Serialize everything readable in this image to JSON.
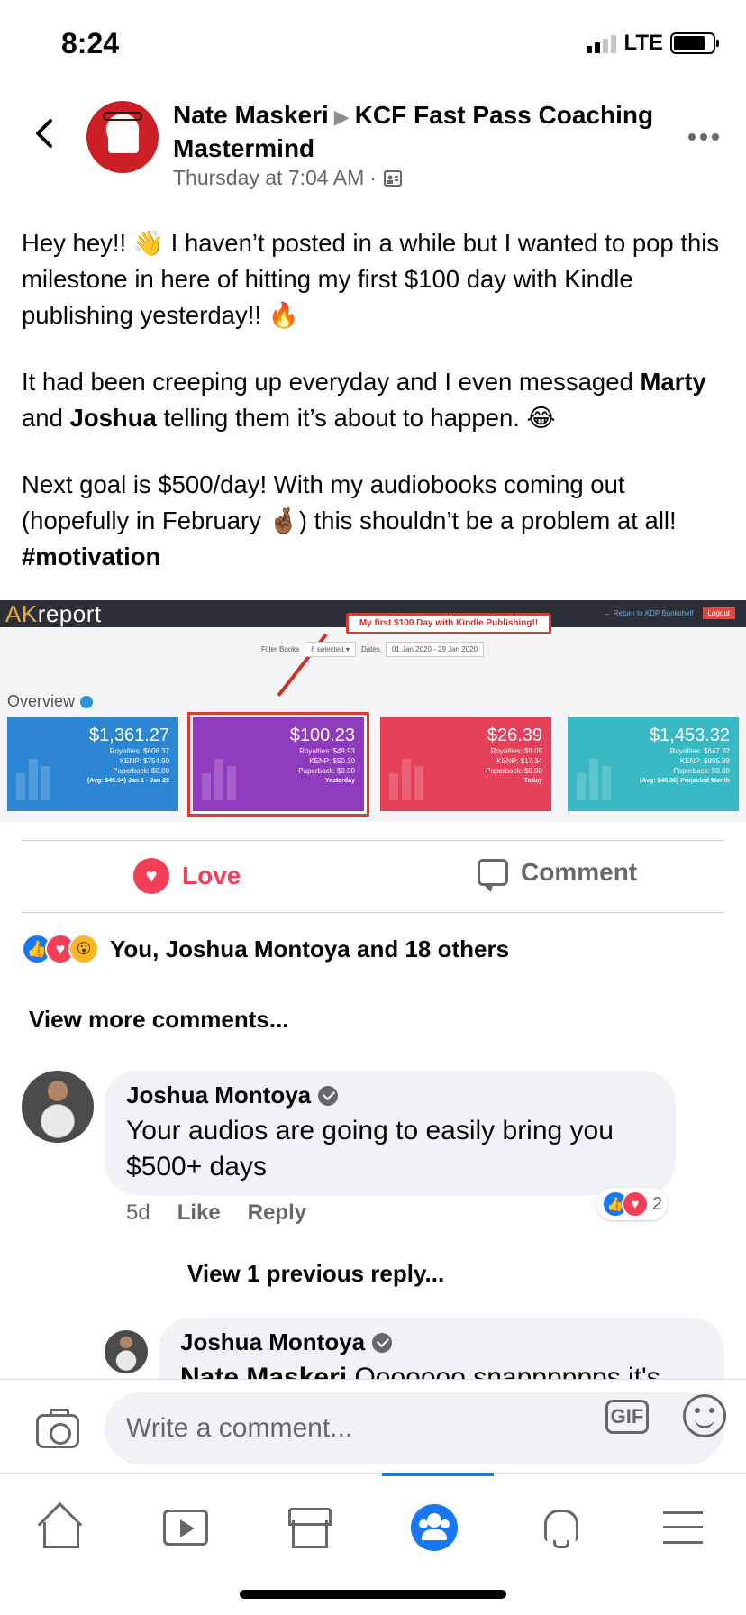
{
  "status_bar": {
    "time": "8:24",
    "network": "LTE"
  },
  "post": {
    "author": "Nate Maskeri",
    "group": "KCF Fast Pass Coaching Mastermind",
    "timestamp": "Thursday at 7:04 AM",
    "paragraph_1": "Hey hey!! 👋 I haven’t posted in a while but I wanted to pop this milestone in here of hitting my first $100 day with Kindle publishing yesterday!! 🔥",
    "paragraph_2_a": "It had been creeping up everyday and I even messaged ",
    "paragraph_2_name1": "Marty",
    "paragraph_2_b": " and ",
    "paragraph_2_name2": "Joshua",
    "paragraph_2_c": " telling them it’s about to happen. 😂",
    "paragraph_3": "Next goal is $500/day! With my audiobooks coming out (hopefully in February 🤞🏾) this shouldn’t be a problem at all!",
    "hashtag": "#motivation"
  },
  "report": {
    "logo_prefix": "AK",
    "logo_suffix": "report",
    "callout": "My first $100 Day with Kindle Publishing!!",
    "back_link": "← Return to KDP Bookshelf",
    "logout": "Logout",
    "filter_label": "Filter Books",
    "filter_value": "8 selected ▾",
    "dates_label": "Dates",
    "dates_value": "01 Jan 2020 - 29 Jan 2020",
    "overview": "Overview",
    "cards": [
      {
        "value": "$1,361.27",
        "royalties": "Royalties: $606.37",
        "kenp": "KENP: $754.90",
        "paperback": "Paperback: $0.00",
        "foot": "(Avg: $46.94) Jan 1 - Jan 29"
      },
      {
        "value": "$100.23",
        "royalties": "Royalties: $49.93",
        "kenp": "KENP: $50.30",
        "paperback": "Paperback: $0.00",
        "foot": "Yesterday"
      },
      {
        "value": "$26.39",
        "royalties": "Royalties: $9.05",
        "kenp": "KENP: $17.34",
        "paperback": "Paperback: $0.00",
        "foot": "Today"
      },
      {
        "value": "$1,453.32",
        "royalties": "Royalties: $647.32",
        "kenp": "KENP: $805.99",
        "paperback": "Paperback: $0.00",
        "foot": "(Avg: $46.88) Projected Month"
      }
    ]
  },
  "actions": {
    "love": "Love",
    "comment": "Comment"
  },
  "reactions_summary": "You, Joshua Montoya and 18 others",
  "view_more_comments": "View more comments...",
  "comments": [
    {
      "name": "Joshua Montoya",
      "text": "Your audios are going to easily bring you $500+ days",
      "age": "5d",
      "like": "Like",
      "reply": "Reply",
      "reaction_count": "2"
    }
  ],
  "view_previous_reply": "View 1 previous reply...",
  "reply": {
    "name": "Joshua Montoya",
    "mention": "Nate Maskeri",
    "text_partial": " Ooooooo snapppppps it's"
  },
  "composer": {
    "placeholder": "Write a comment...",
    "gif": "GIF"
  },
  "colors": {
    "love": "#f33e58",
    "accent": "#1877f2",
    "muted": "#65676b"
  }
}
